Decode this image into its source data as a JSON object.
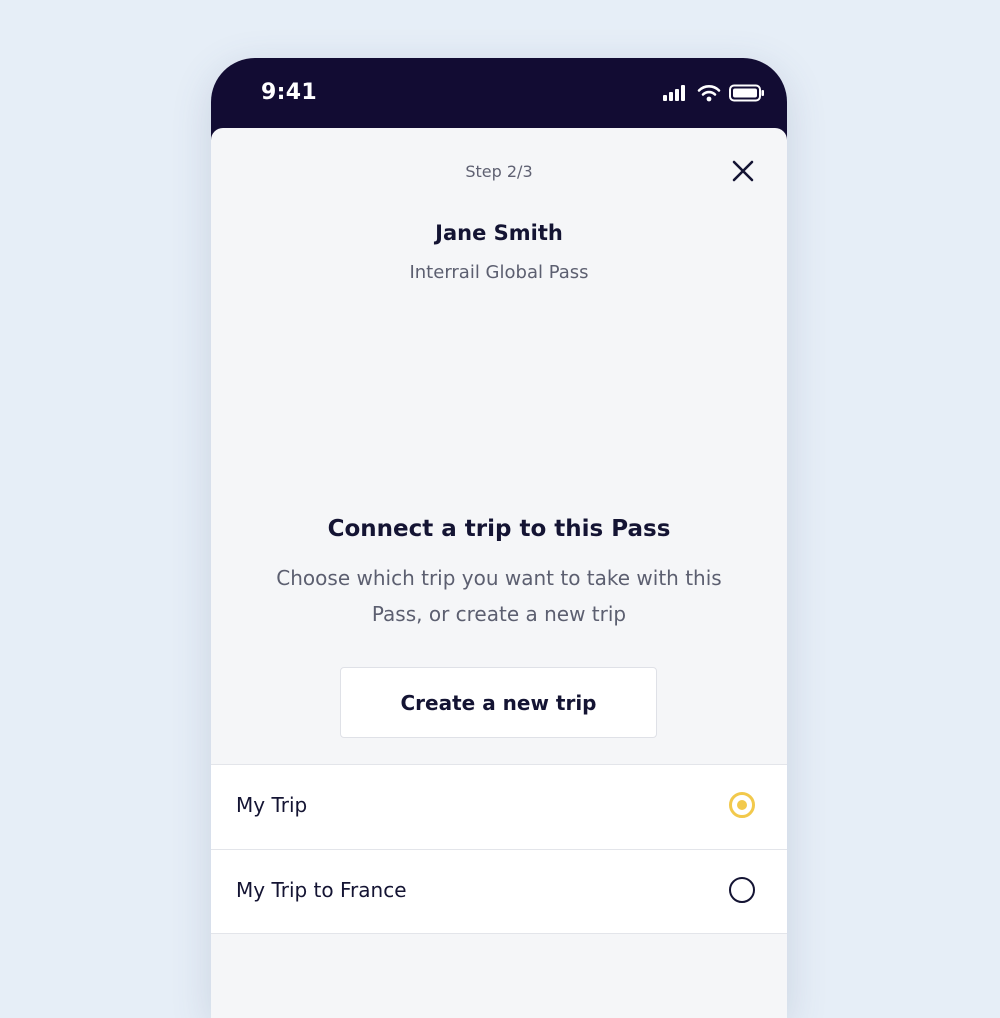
{
  "status_bar": {
    "time": "9:41",
    "icons": [
      "cellular-signal-icon",
      "wifi-icon",
      "battery-icon"
    ]
  },
  "header": {
    "step": "Step 2/3",
    "close_icon": "close-icon",
    "name": "Jane Smith",
    "pass": "Interrail Global Pass"
  },
  "main": {
    "title": "Connect a trip to this Pass",
    "description": "Choose which trip you want to take with this Pass, or create a new trip",
    "create_button": "Create a new trip"
  },
  "trips": [
    {
      "label": "My Trip",
      "selected": true
    },
    {
      "label": "My Trip to France",
      "selected": false
    }
  ],
  "colors": {
    "status_bar_bg": "#120c33",
    "accent": "#f2c94c",
    "text_primary": "#141433",
    "text_secondary": "#5c5f70",
    "sheet_bg": "#f5f6f8",
    "page_bg": "#e6eef7"
  }
}
